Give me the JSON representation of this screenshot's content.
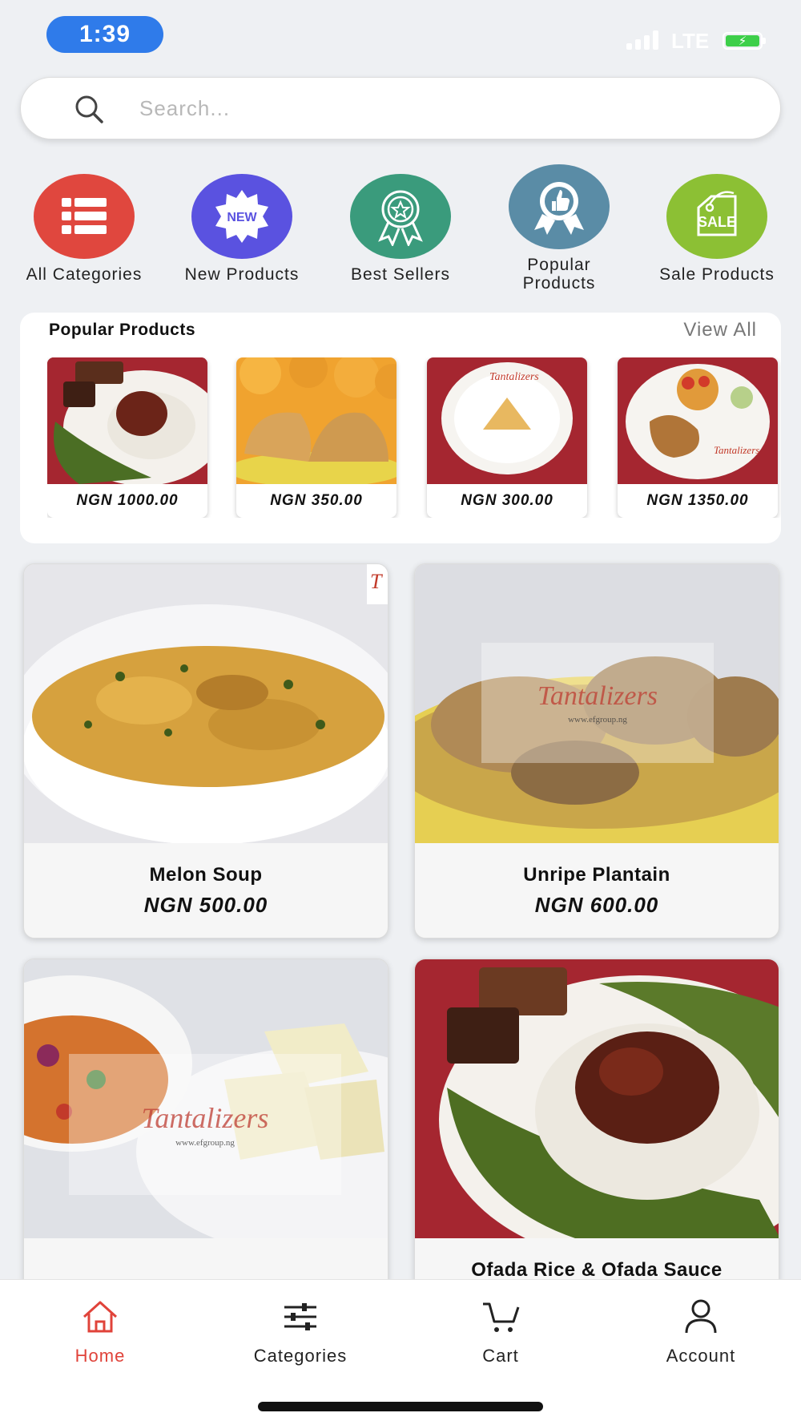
{
  "status_bar": {
    "time": "1:39",
    "network": "LTE",
    "battery_icon": "battery-charging-icon"
  },
  "search": {
    "placeholder": "Search...",
    "icon": "search-icon"
  },
  "categories": [
    {
      "label": "All Categories",
      "color": "#e0473e",
      "icon": "list-icon"
    },
    {
      "label": "New Products",
      "color": "#5a52e0",
      "icon": "new-badge-icon"
    },
    {
      "label": "Best Sellers",
      "color": "#3a9b7c",
      "icon": "award-ribbon-icon"
    },
    {
      "label": "Popular Products",
      "color": "#5a8ca6",
      "icon": "thumbs-up-award-icon"
    },
    {
      "label": "Sale Products",
      "color": "#8cc034",
      "icon": "sale-tag-icon"
    }
  ],
  "popular": {
    "title": "Popular Products",
    "view_all": "View All",
    "items": [
      {
        "price": "NGN 1000.00",
        "image": "rice-and-meat-photo"
      },
      {
        "price": "NGN 350.00",
        "image": "pastries-photo"
      },
      {
        "price": "NGN 300.00",
        "image": "samosa-plate-photo"
      },
      {
        "price": "NGN 1350.00",
        "image": "chicken-plate-photo"
      }
    ]
  },
  "products": [
    {
      "name": "Melon Soup",
      "price": "NGN 500.00",
      "image": "melon-soup-photo"
    },
    {
      "name": "Unripe Plantain",
      "price": "NGN 600.00",
      "image": "unripe-plantain-photo",
      "watermark": "Tantalizers",
      "watermark_url": "www.efgroup.ng"
    },
    {
      "name": "",
      "price": "",
      "image": "yam-and-soup-photo",
      "watermark": "Tantalizers",
      "watermark_url": "www.efgroup.ng"
    },
    {
      "name": "Ofada Rice & Ofada Sauce",
      "price": "",
      "image": "ofada-rice-photo"
    }
  ],
  "bottom_nav": [
    {
      "label": "Home",
      "icon": "home-icon",
      "active": true
    },
    {
      "label": "Categories",
      "icon": "sliders-icon",
      "active": false
    },
    {
      "label": "Cart",
      "icon": "cart-icon",
      "active": false
    },
    {
      "label": "Account",
      "icon": "user-icon",
      "active": false
    }
  ],
  "colors": {
    "accent": "#e0433a",
    "time_pill": "#2f7bea",
    "background": "#eef0f3"
  }
}
